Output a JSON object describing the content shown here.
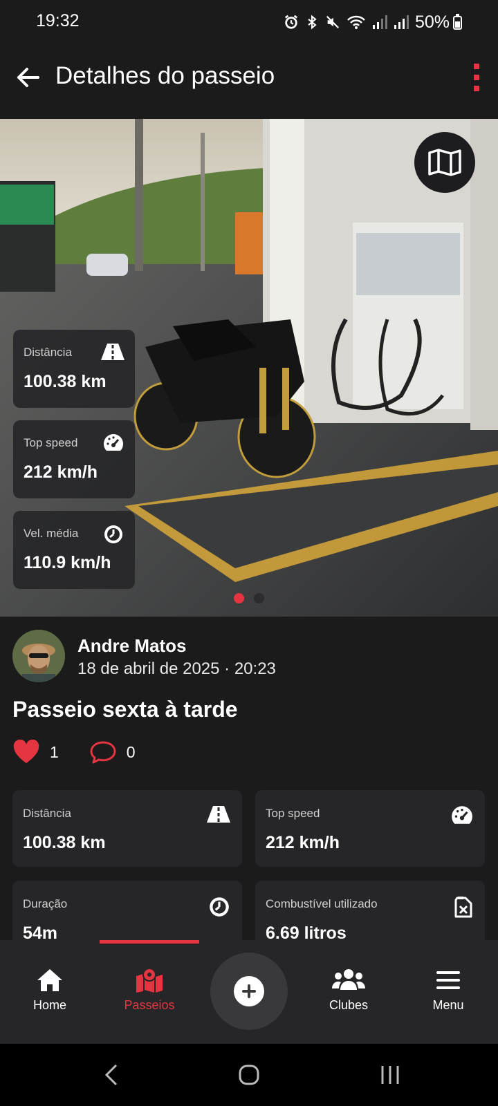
{
  "status_bar": {
    "time": "19:32",
    "battery": "50%"
  },
  "header": {
    "title": "Detalhes do passeio"
  },
  "hero": {
    "map_button": "map-icon",
    "overlay_stats": [
      {
        "label": "Distância",
        "value": "100.38 km",
        "icon": "road-icon"
      },
      {
        "label": "Top speed",
        "value": "212 km/h",
        "icon": "speedometer-icon"
      },
      {
        "label": "Vel. média",
        "value": "110.9 km/h",
        "icon": "timer-icon"
      }
    ],
    "pagination": {
      "total": 2,
      "current": 1
    }
  },
  "post": {
    "author": "Andre Matos",
    "date": "18 de abril de 2025 · 20:23",
    "title": "Passeio sexta à tarde",
    "likes": "1",
    "comments": "0"
  },
  "stats": [
    {
      "label": "Distância",
      "value": "100.38 km",
      "icon": "road-icon"
    },
    {
      "label": "Top speed",
      "value": "212 km/h",
      "icon": "speedometer-icon"
    },
    {
      "label": "Duração",
      "value": "54m",
      "icon": "timer-icon"
    },
    {
      "label": "Combustível utilizado",
      "value": "6.69 litros",
      "icon": "fuel-can-icon"
    }
  ],
  "bottom_nav": {
    "items": [
      {
        "label": "Home",
        "icon": "home-icon"
      },
      {
        "label": "Passeios",
        "icon": "map-pin-icon",
        "active": true
      },
      {
        "label": "Clubes",
        "icon": "group-icon"
      },
      {
        "label": "Menu",
        "icon": "hamburger-icon"
      }
    ],
    "fab_icon": "plus-icon"
  },
  "colors": {
    "accent": "#e43541",
    "background": "#1b1b1c",
    "card": "#262628"
  }
}
